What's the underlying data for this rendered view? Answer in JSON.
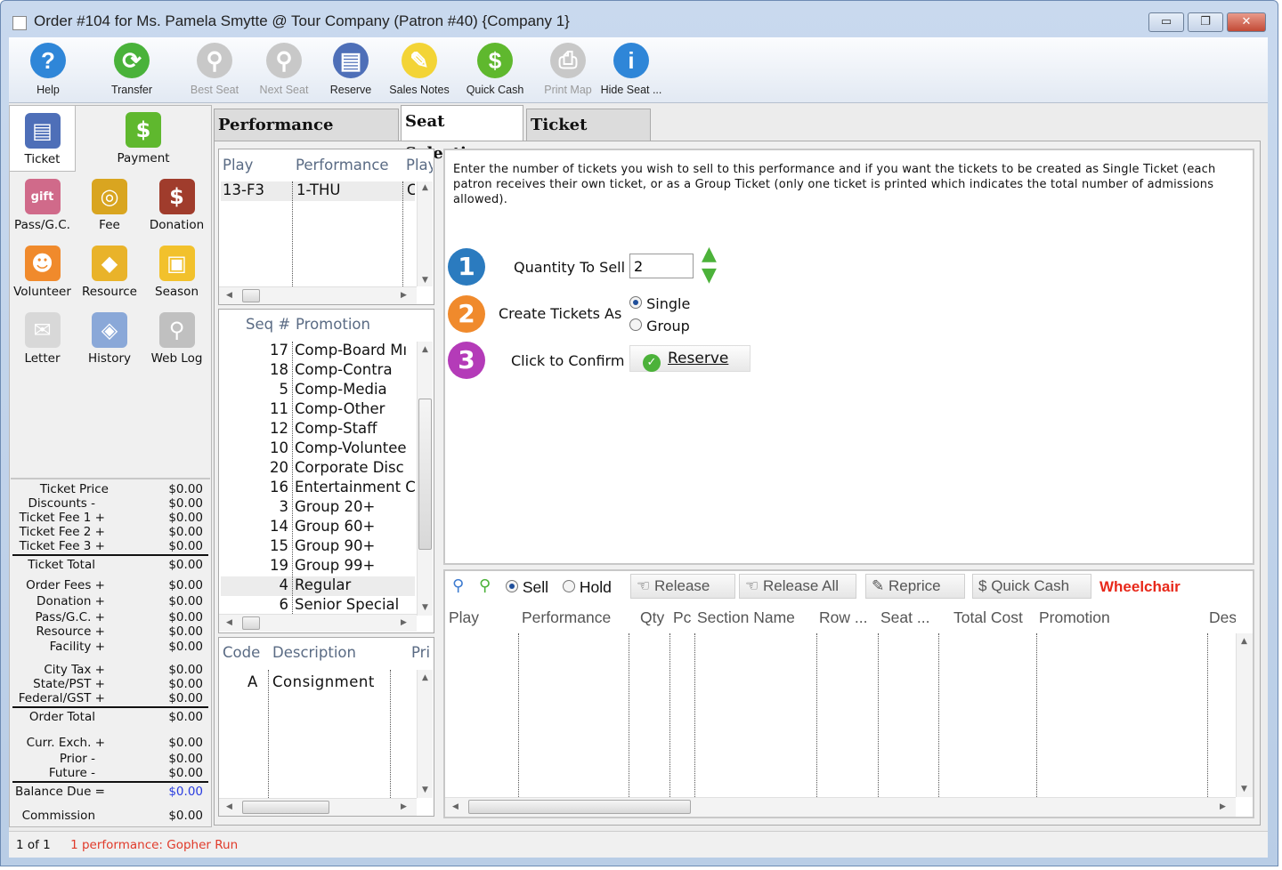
{
  "window": {
    "title": "Order #104 for Ms. Pamela Smytte @ Tour Company (Patron #40) {Company 1}",
    "minimize": "▭",
    "maximize": "❐",
    "close": "✕"
  },
  "toolbar": [
    {
      "label": "Help",
      "icon": "help-icon",
      "enabled": true,
      "color": "#2f86d8",
      "glyph": "?"
    },
    {
      "label": "Transfer",
      "icon": "transfer-icon",
      "enabled": true,
      "color": "#49b23a",
      "glyph": "⟳"
    },
    {
      "label": "Best Seat",
      "icon": "magnifier-icon",
      "enabled": false,
      "color": "#c8c8c8",
      "glyph": "⚲"
    },
    {
      "label": "Next Seat",
      "icon": "magnifier-plus-icon",
      "enabled": false,
      "color": "#c8c8c8",
      "glyph": "⚲"
    },
    {
      "label": "Reserve",
      "icon": "ticket-icon",
      "enabled": true,
      "color": "#4e6fb8",
      "glyph": "▤"
    },
    {
      "label": "Sales Notes",
      "icon": "sticky-note-icon",
      "enabled": true,
      "color": "#f3d436",
      "glyph": "✎"
    },
    {
      "label": "Quick Cash",
      "icon": "dollar-icon",
      "enabled": true,
      "color": "#5fb82e",
      "glyph": "$"
    },
    {
      "label": "Print Map",
      "icon": "printer-icon",
      "enabled": false,
      "color": "#c8c8c8",
      "glyph": "⎙"
    },
    {
      "label": "Hide Seat ...",
      "icon": "info-icon",
      "enabled": true,
      "color": "#2f86d8",
      "glyph": "i"
    }
  ],
  "left_nav": [
    {
      "label": "Ticket",
      "icon": "ticket-icon",
      "color": "#4e6fb8",
      "glyph": "▤"
    },
    {
      "label": "Payment",
      "icon": "dollar-icon",
      "color": "#5fb82e",
      "glyph": "$"
    },
    {
      "label": "Pass/G.C.",
      "icon": "gift-card-icon",
      "color": "#d06a8a",
      "glyph": "gift"
    },
    {
      "label": "Fee",
      "icon": "coins-icon",
      "color": "#d9a520",
      "glyph": "◎"
    },
    {
      "label": "Donation",
      "icon": "money-box-icon",
      "color": "#a03c2c",
      "glyph": "$"
    },
    {
      "label": "Volunteer",
      "icon": "people-icon",
      "color": "#f08a2c",
      "glyph": "☻"
    },
    {
      "label": "Resource",
      "icon": "resource-icon",
      "color": "#e9b32a",
      "glyph": "◆"
    },
    {
      "label": "Season",
      "icon": "box-icon",
      "color": "#f2c12c",
      "glyph": "▣"
    },
    {
      "label": "Letter",
      "icon": "letter-icon",
      "color": "#d8d8d8",
      "glyph": "✉"
    },
    {
      "label": "History",
      "icon": "history-icon",
      "color": "#8aa8d8",
      "glyph": "◈"
    },
    {
      "label": "Web Log",
      "icon": "web-log-icon",
      "color": "#c0c0c0",
      "glyph": "⚲"
    }
  ],
  "summary": [
    {
      "label": "Ticket Price",
      "value": "$0.00"
    },
    {
      "label": "Discounts -",
      "value": "$0.00"
    },
    {
      "label": "Ticket Fee 1 +",
      "value": "$0.00"
    },
    {
      "label": "Ticket Fee 2 +",
      "value": "$0.00"
    },
    {
      "label": "Ticket Fee 3 +",
      "value": "$0.00"
    },
    {
      "label": "Ticket Total",
      "value": "$0.00"
    },
    {
      "label": "Order Fees +",
      "value": "$0.00"
    },
    {
      "label": "Donation +",
      "value": "$0.00"
    },
    {
      "label": "Pass/G.C. +",
      "value": "$0.00"
    },
    {
      "label": "Resource +",
      "value": "$0.00"
    },
    {
      "label": "Facility +",
      "value": "$0.00"
    },
    {
      "label": "City Tax +",
      "value": "$0.00"
    },
    {
      "label": "State/PST +",
      "value": "$0.00"
    },
    {
      "label": "Federal/GST +",
      "value": "$0.00"
    },
    {
      "label": "Order Total",
      "value": "$0.00"
    },
    {
      "label": "Curr. Exch. +",
      "value": "$0.00"
    },
    {
      "label": "Prior -",
      "value": "$0.00"
    },
    {
      "label": "Future -",
      "value": "$0.00"
    },
    {
      "label": "Balance Due =",
      "value": "$0.00"
    },
    {
      "label": "Commission",
      "value": "$0.00"
    }
  ],
  "status": {
    "page": "1 of 1",
    "message": "1 performance: Gopher Run"
  },
  "tabs": [
    {
      "label": "Performance Selection"
    },
    {
      "label": "Seat Selection",
      "active": true
    },
    {
      "label": "Ticket Review"
    }
  ],
  "performances": {
    "headers": [
      "Play",
      "Performance",
      "Play"
    ],
    "rows": [
      [
        "13-F3",
        "1-THU",
        "C"
      ]
    ]
  },
  "promotions": {
    "headers": [
      "Seq #",
      "Promotion"
    ],
    "rows": [
      [
        "17",
        "Comp-Board Mı"
      ],
      [
        "18",
        "Comp-Contra"
      ],
      [
        "5",
        "Comp-Media"
      ],
      [
        "11",
        "Comp-Other"
      ],
      [
        "12",
        "Comp-Staff"
      ],
      [
        "10",
        "Comp-Voluntee"
      ],
      [
        "20",
        "Corporate Disc"
      ],
      [
        "16",
        "Entertainment C"
      ],
      [
        "3",
        "Group 20+"
      ],
      [
        "14",
        "Group 60+"
      ],
      [
        "15",
        "Group 90+"
      ],
      [
        "19",
        "Group 99+"
      ],
      [
        "4",
        "Regular"
      ],
      [
        "6",
        "Senior Special"
      ]
    ],
    "selected": "Regular"
  },
  "codes": {
    "headers": [
      "Code",
      "Description",
      "Pri"
    ],
    "rows": [
      [
        "A",
        "Consignment"
      ]
    ]
  },
  "seat_selection": {
    "instructions": "Enter the number of tickets you wish to sell to this performance and if you want the tickets to be created as Single Ticket (each patron receives their own ticket, or as a Group Ticket (only one ticket is printed which indicates the total number of admissions allowed).",
    "step1": {
      "num": "1",
      "label": "Quantity To Sell",
      "value": "2",
      "color": "#2b7bbf"
    },
    "step2": {
      "num": "2",
      "label": "Create Tickets As",
      "options": [
        "Single",
        "Group"
      ],
      "selected": "Single",
      "color": "#f08a2c"
    },
    "step3": {
      "num": "3",
      "label": "Click to Confirm",
      "button": "Reserve",
      "color": "#b43bb8"
    }
  },
  "cart": {
    "mode_options": [
      "Sell",
      "Hold"
    ],
    "mode_selected": "Sell",
    "buttons": [
      "Release",
      "Release All",
      "Reprice",
      "Quick Cash"
    ],
    "wheelchair": "Wheelchair",
    "headers": [
      "Play",
      "Performance",
      "Qty",
      "Pc",
      "Section Name",
      "Row ...",
      "Seat ...",
      "Total Cost",
      "Promotion",
      "Desc"
    ]
  }
}
